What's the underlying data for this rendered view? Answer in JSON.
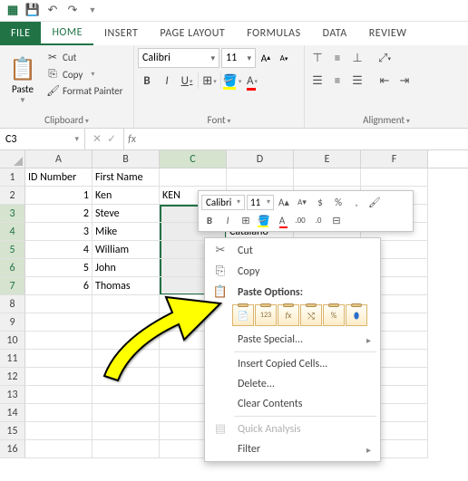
{
  "titlebar": {
    "icons": [
      "excel",
      "save",
      "undo",
      "redo"
    ]
  },
  "tabs": {
    "file": "FILE",
    "home": "HOME",
    "insert": "INSERT",
    "page_layout": "PAGE LAYOUT",
    "formulas": "FORMULAS",
    "data": "DATA",
    "review": "REVIEW"
  },
  "ribbon": {
    "clipboard": {
      "paste": "Paste",
      "cut": "Cut",
      "copy": "Copy",
      "format_painter": "Format Painter",
      "label": "Clipboard"
    },
    "font": {
      "name": "Calibri",
      "size": "11",
      "label": "Font"
    },
    "alignment": {
      "label": "Alignment"
    }
  },
  "namebox": "C3",
  "fx": "fx",
  "columns": [
    "A",
    "B",
    "C",
    "D",
    "E",
    "F"
  ],
  "row_count": 16,
  "headers": {
    "a": "ID Number",
    "b": "First Name"
  },
  "rows": [
    {
      "id": "1",
      "name": "Ken"
    },
    {
      "id": "2",
      "name": "Steve"
    },
    {
      "id": "3",
      "name": "Mike"
    },
    {
      "id": "4",
      "name": "William"
    },
    {
      "id": "5",
      "name": "John"
    },
    {
      "id": "6",
      "name": "Thomas"
    }
  ],
  "c2_value": "KEN",
  "d4_value": "Catalano",
  "mini": {
    "font": "Calibri",
    "size": "11"
  },
  "ctx": {
    "cut": "Cut",
    "copy": "Copy",
    "paste_options": "Paste Options:",
    "paste_special": "Paste Special...",
    "insert": "Insert Copied Cells...",
    "delete": "Delete...",
    "clear": "Clear Contents",
    "quick": "Quick Analysis",
    "filter": "Filter"
  }
}
